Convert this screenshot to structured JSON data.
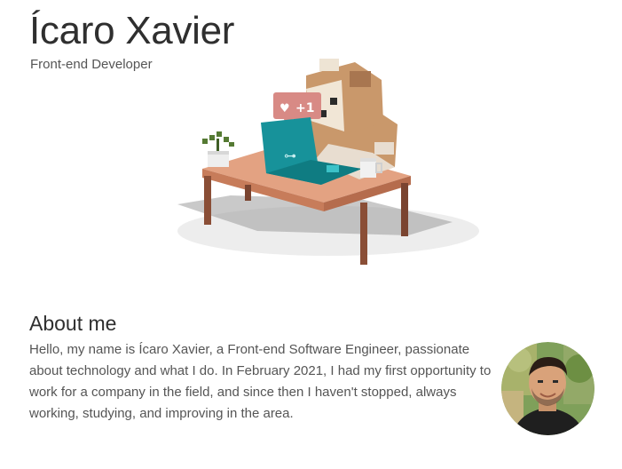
{
  "header": {
    "name": "Ícaro Xavier",
    "role": "Front-end Developer"
  },
  "hero": {
    "illustration": "voxel-dog-at-desk-illustration",
    "like_badge": "+1"
  },
  "about": {
    "title": "About me",
    "text": "Hello, my name is Ícaro Xavier, a Front-end Software Engineer, passionate about technology and what I do. In February 2021, I had my first opportunity to work for a company in the field, and since then I haven't stopped, always working, studying, and improving in the area.",
    "avatar": "profile-photo"
  },
  "colors": {
    "heading": "#2f2f2f",
    "body_text": "#555555",
    "desk": "#d8906d",
    "laptop": "#17929a",
    "dog": "#c9986b"
  }
}
